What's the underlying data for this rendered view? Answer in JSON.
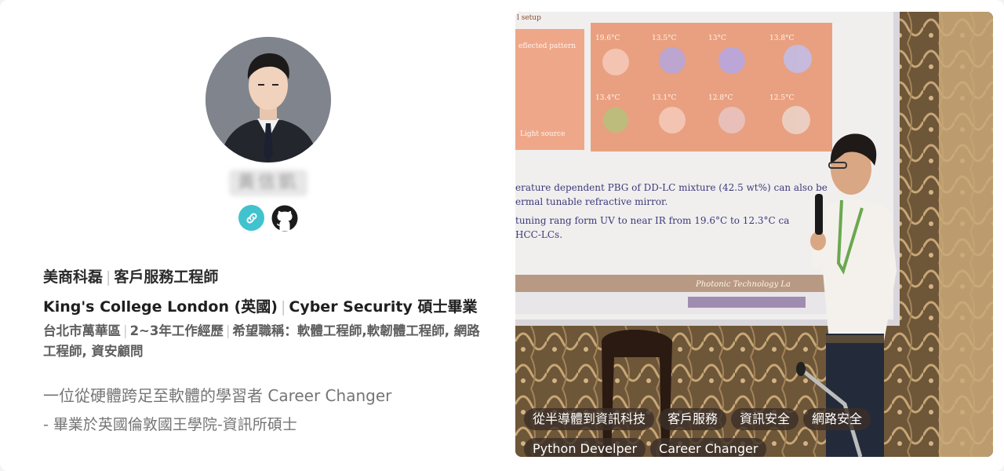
{
  "profile": {
    "name": "黃信凱",
    "links": {
      "website_icon": "link-icon",
      "github_icon": "github-icon"
    },
    "company": "美商科磊",
    "job_title": "客戶服務工程師",
    "school": "King's College London (英國)",
    "degree": "Cyber Security 碩士畢業",
    "location": "台北市萬華區",
    "experience": "2~3年工作經歷",
    "desired_jobs": "希望職稱：軟體工程師,軟韌體工程師, 網路工程師, 資安顧問",
    "tagline": "一位從硬體跨足至軟體的學習者 Career Changer",
    "description": "- 畢業於英國倫敦國王學院-資訊所碩士"
  },
  "tags": [
    "從半導體到資訊科技",
    "客戶服務",
    "資訊安全",
    "網路安全",
    "Python Develper",
    "Career Changer"
  ],
  "slide": {
    "heading": "l setup",
    "reflected": "eflected pattern",
    "light_source": "Light source",
    "temps_row1": [
      "19.6°C",
      "13.5°C",
      "13°C",
      "13.8°C"
    ],
    "temps_row2": [
      "13.4°C",
      "13.1°C",
      "12.8°C",
      "12.5°C"
    ],
    "line1": "erature dependent PBG of DD-LC mixture (42.5 wt%) can also be",
    "line2": "ermal tunable refractive mirror.",
    "line3": "tuning rang form UV to near IR from 19.6°C to 12.3°C ca",
    "line4": "HCC-LCs.",
    "footer": "Photonic Technology La"
  },
  "colors": {
    "accent_link": "#41c2cf",
    "tag_bg": "#3c3028"
  }
}
